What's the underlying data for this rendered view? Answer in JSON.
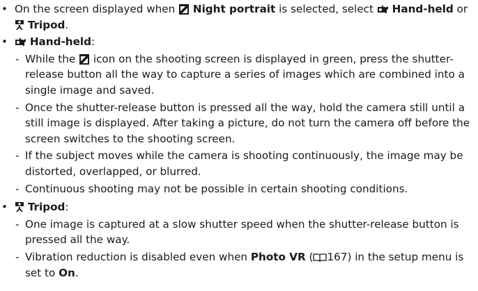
{
  "intro": {
    "prefix": "On the screen displayed when ",
    "night_label": "Night portrait",
    "middle": " is selected, select ",
    "handheld_label": "Hand-held",
    "or": " or ",
    "tripod_label": "Tripod",
    "end": "."
  },
  "handheld": {
    "title": "Hand-held",
    "colon": ":",
    "items": [
      {
        "before": "While the ",
        "after": " icon on the shooting screen is displayed in green, press the shutter-release button all the way to capture a series of images which are combined into a single image and saved."
      },
      {
        "text": "Once the shutter-release button is pressed all the way, hold the camera still until a still image is displayed. After taking a picture, do not turn the camera off before the screen switches to the shooting screen."
      },
      {
        "text": "If the subject moves while the camera is shooting continuously, the image may be distorted, overlapped, or blurred."
      },
      {
        "text": "Continuous shooting may not be possible in certain shooting conditions."
      }
    ]
  },
  "tripod": {
    "title": "Tripod",
    "colon": ":",
    "items": [
      {
        "text": "One image is captured at a slow shutter speed when the shutter-release button is pressed all the way."
      },
      {
        "before": "Vibration reduction is disabled even when ",
        "photo_vr": "Photo VR",
        "ref_open": " (",
        "page": "167",
        "ref_close": ") in the setup menu is set to ",
        "on": "On",
        "end": "."
      }
    ]
  },
  "icons": {
    "bullet": "•",
    "dash": "-",
    "night_portrait": "night-portrait-icon",
    "handheld": "hand-held-icon",
    "tripod": "tripod-icon",
    "page_ref": "book-icon"
  }
}
